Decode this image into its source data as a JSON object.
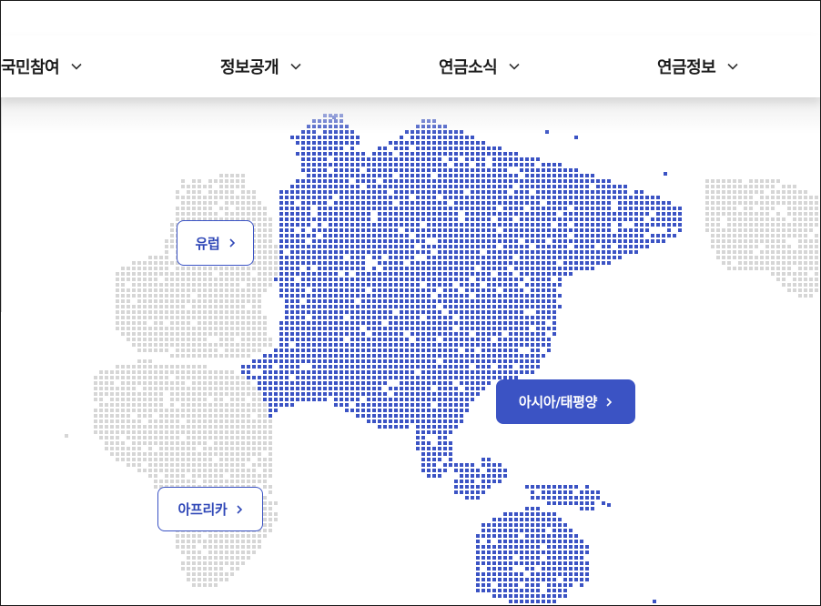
{
  "nav": {
    "items": [
      {
        "label": "국민참여"
      },
      {
        "label": "정보공개"
      },
      {
        "label": "연금소식"
      },
      {
        "label": "연금정보"
      }
    ]
  },
  "regions": {
    "europe": {
      "label": "유럽"
    },
    "asia_pacific": {
      "label": "아시아/태평양"
    },
    "africa": {
      "label": "아프리카"
    }
  },
  "colors": {
    "accent": "#3b53c4",
    "active_dots": "#3b53c4",
    "inactive_dots": "#d6d6d6"
  },
  "icons": {
    "nav_chevron": "chevron-down-icon",
    "region_arrow": "chevron-right-icon"
  }
}
